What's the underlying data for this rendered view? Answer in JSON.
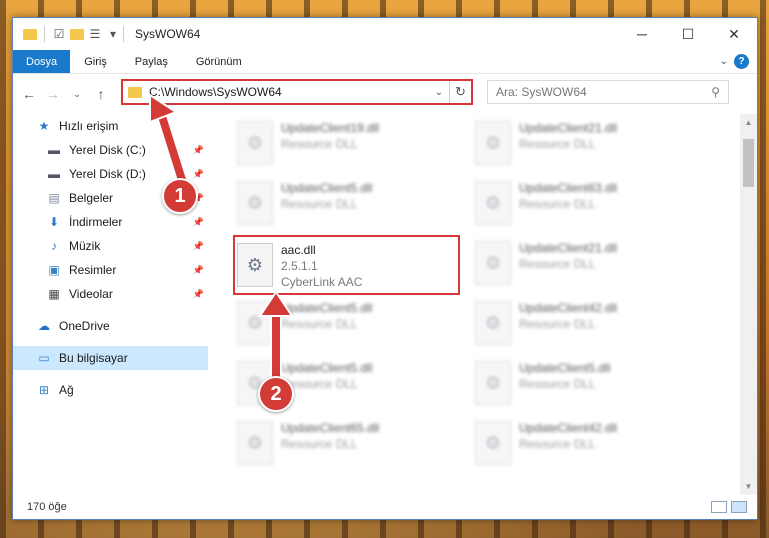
{
  "window": {
    "title": "SysWOW64",
    "controls": {
      "minimize": "─",
      "maximize": "☐",
      "close": "✕"
    }
  },
  "ribbon": {
    "tabs": [
      {
        "label": "Dosya",
        "active": true
      },
      {
        "label": "Giriş"
      },
      {
        "label": "Paylaş"
      },
      {
        "label": "Görünüm"
      }
    ]
  },
  "nav": {
    "address": "C:\\Windows\\SysWOW64",
    "search_placeholder": "Ara: SysWOW64"
  },
  "sidebar": {
    "items": [
      {
        "label": "Hızlı erişim",
        "icon": "star-icon"
      },
      {
        "label": "Yerel Disk (C:)",
        "icon": "drive-icon"
      },
      {
        "label": "Yerel Disk (D:)",
        "icon": "drive-icon"
      },
      {
        "label": "Belgeler",
        "icon": "documents-icon"
      },
      {
        "label": "İndirmeler",
        "icon": "download-icon"
      },
      {
        "label": "Müzik",
        "icon": "music-icon"
      },
      {
        "label": "Resimler",
        "icon": "pictures-icon"
      },
      {
        "label": "Videolar",
        "icon": "video-icon"
      },
      {
        "label": "OneDrive",
        "icon": "cloud-icon"
      },
      {
        "label": "Bu bilgisayar",
        "icon": "computer-icon"
      },
      {
        "label": "Ağ",
        "icon": "network-icon"
      }
    ]
  },
  "files": {
    "col1": [
      {
        "name": "UpdateClient19.dll",
        "sub": "Resource DLL"
      },
      {
        "name": "UpdateClient5.dll",
        "sub": "Resource DLL"
      },
      {
        "name": "aac.dll",
        "version": "2.5.1.1",
        "company": "CyberLink AAC"
      },
      {
        "name": "UpdateClient5.dll",
        "sub": "Resource DLL"
      },
      {
        "name": "UpdateClient5.dll",
        "sub": "Resource DLL"
      },
      {
        "name": "UpdateClient65.dll",
        "sub": "Resource DLL"
      }
    ],
    "col2": [
      {
        "name": "UpdateClient21.dll",
        "sub": "Resource DLL"
      },
      {
        "name": "UpdateClient63.dll",
        "sub": "Resource DLL"
      },
      {
        "name": "UpdateClient21.dll",
        "sub": "Resource DLL"
      },
      {
        "name": "UpdateClient42.dll",
        "sub": "Resource DLL"
      },
      {
        "name": "UpdateClient5.dll",
        "sub": "Resource DLL"
      },
      {
        "name": "UpdateClient42.dll",
        "sub": "Resource DLL"
      }
    ]
  },
  "status": {
    "count": "170 öğe"
  },
  "callouts": {
    "one": "1",
    "two": "2"
  },
  "colors": {
    "accent": "#1979ca",
    "highlight": "#d8373a",
    "selected": "#cce8ff"
  }
}
